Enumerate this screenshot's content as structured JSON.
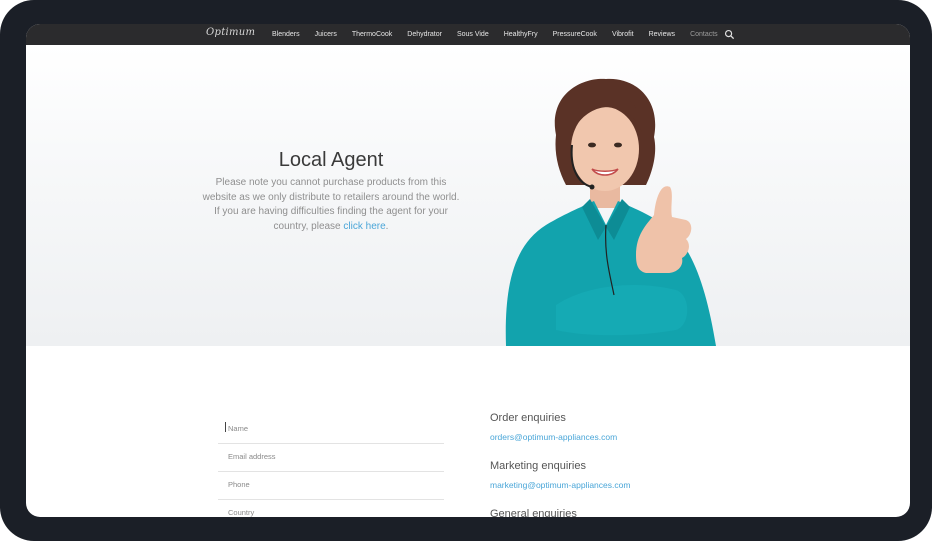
{
  "nav": {
    "logo": "Optimum",
    "items": [
      {
        "label": "Blenders"
      },
      {
        "label": "Juicers"
      },
      {
        "label": "ThermoCook"
      },
      {
        "label": "Dehydrator"
      },
      {
        "label": "Sous Vide"
      },
      {
        "label": "HealthyFry"
      },
      {
        "label": "PressureCook"
      },
      {
        "label": "Vibrofit"
      },
      {
        "label": "Reviews"
      },
      {
        "label": "Contacts"
      }
    ],
    "search_icon": "search-icon"
  },
  "hero": {
    "title": "Local Agent",
    "body": "Please note you cannot purchase products from this website as we only distribute to retailers around the world. If you are having difficulties finding the agent for your country, please ",
    "link": "click here",
    "after_link": "."
  },
  "form": {
    "name_placeholder": "Name",
    "email_placeholder": "Email address",
    "phone_placeholder": "Phone",
    "country_placeholder": "Country"
  },
  "contacts": [
    {
      "title": "Order enquiries",
      "email": "orders@optimum-appliances.com"
    },
    {
      "title": "Marketing enquiries",
      "email": "marketing@optimum-appliances.com"
    },
    {
      "title": "General enquiries",
      "email": ""
    }
  ],
  "colors": {
    "link": "#4aa6d8",
    "nav_bg": "#2b2b2d",
    "frame": "#1b1f27"
  }
}
